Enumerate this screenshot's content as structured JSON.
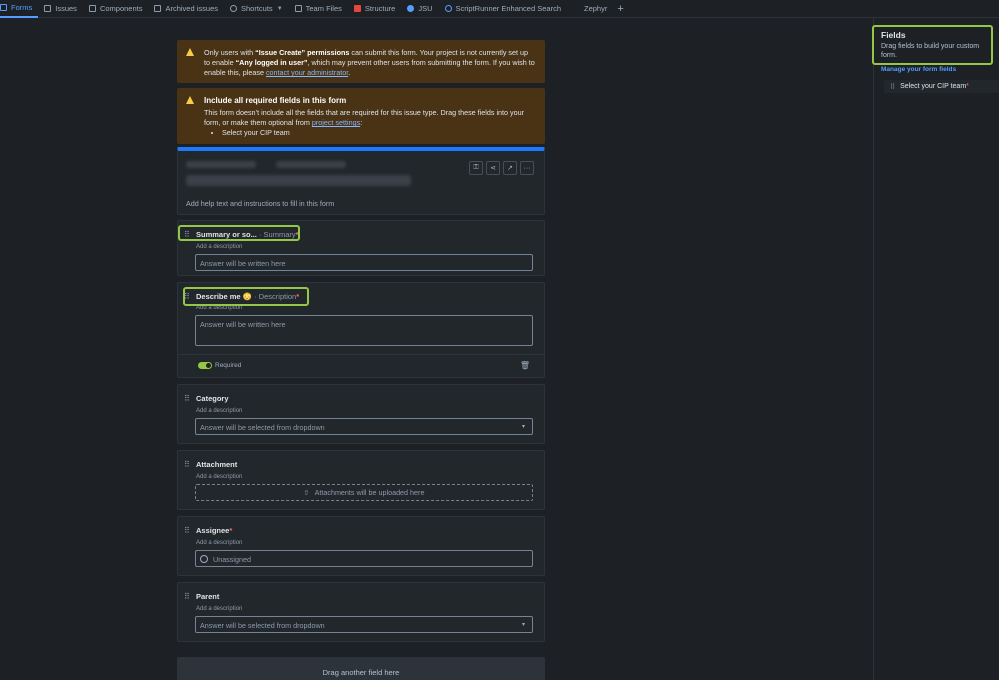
{
  "nav": {
    "tabs": [
      {
        "label": "Forms",
        "icon": "forms-icon"
      },
      {
        "label": "Issues",
        "icon": "issues-icon"
      },
      {
        "label": "Components",
        "icon": "components-icon"
      },
      {
        "label": "Archived issues",
        "icon": "archive-icon"
      },
      {
        "label": "Shortcuts",
        "icon": "link-icon"
      },
      {
        "label": "Team Files",
        "icon": "team-files-icon"
      },
      {
        "label": "Structure",
        "icon": "structure-icon"
      },
      {
        "label": "JSU",
        "icon": "jsu-icon"
      },
      {
        "label": "ScriptRunner Enhanced Search",
        "icon": "scriptrunner-icon"
      },
      {
        "label": "Zephyr",
        "icon": "zephyr-icon"
      }
    ],
    "add_symbol": "+"
  },
  "warning1": {
    "t1": "Only users with ",
    "b1": "“Issue Create” permissions",
    "t2": " can submit this form. Your project is not currently set up to enable ",
    "b2": "“Any logged in user”",
    "t3": ", which may prevent other users from submitting the form. If you wish to enable this, please ",
    "link": "contact your administrator",
    "t4": "."
  },
  "warning2": {
    "title": "Include all required fields in this form",
    "t1": "This form doesn’t include all the fields that are required for this issue type. Drag these fields into your form, or make them optional from ",
    "link": "project settings",
    "t2": ":",
    "items": [
      "Select your CIP team"
    ]
  },
  "form_header": {
    "help_text": "Add help text and instructions to fill in this form"
  },
  "fields": {
    "summary": {
      "name": "Summary or so...",
      "sub": " · Summary",
      "req": "*",
      "desc": "Add a description",
      "placeholder": "Answer will be written here"
    },
    "describe": {
      "name": "Describe me 😳",
      "sub": " · Description",
      "req": "*",
      "desc": "Add a description",
      "placeholder": "Answer will be written here",
      "required_label": "Required"
    },
    "category": {
      "name": "Category",
      "desc": "Add a description",
      "placeholder": "Answer will be selected from dropdown"
    },
    "attachment": {
      "name": "Attachment",
      "desc": "Add a description",
      "placeholder": "Attachments will be uploaded here"
    },
    "assignee": {
      "name": "Assignee",
      "req": "*",
      "desc": "Add a description",
      "placeholder": "Unassigned"
    },
    "parent": {
      "name": "Parent",
      "desc": "Add a description",
      "placeholder": "Answer will be selected from dropdown"
    }
  },
  "dropzone": "Drag another field here",
  "side": {
    "title": "Fields",
    "subtitle": "Drag fields to build your custom form.",
    "manage_link": "Manage your form fields",
    "item": "Select your CIP team",
    "item_req": "*"
  },
  "colors": {
    "accent": "#579dff",
    "highlight": "#94c748",
    "warning_bg": "#4a3214",
    "required": "#f87168"
  }
}
